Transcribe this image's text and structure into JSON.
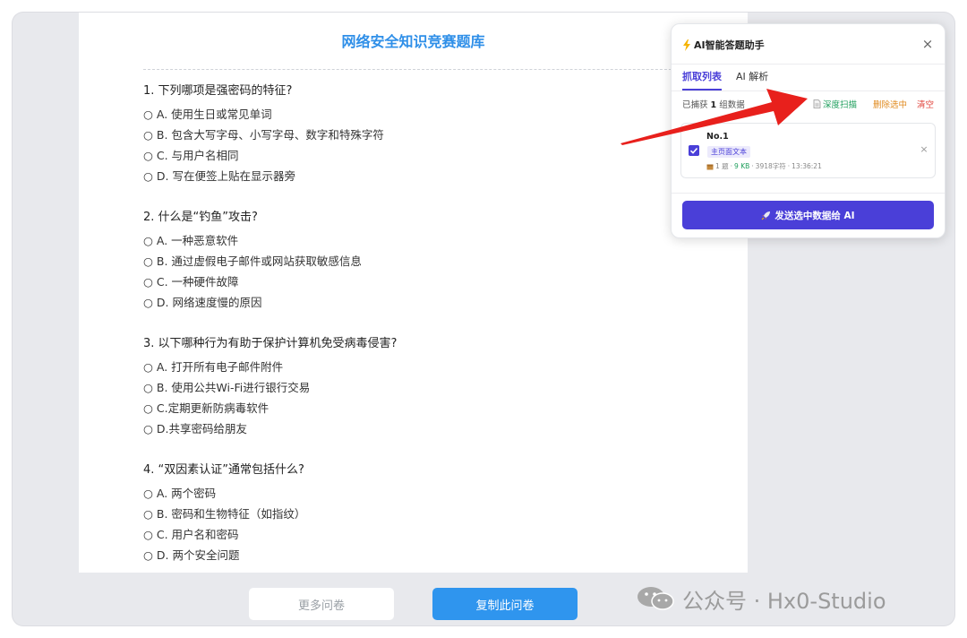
{
  "quiz": {
    "title": "网络安全知识竞赛题库",
    "questions": [
      {
        "text": "1. 下列哪项是强密码的特征?",
        "options": [
          "○ A. 使用生日或常见单词",
          "○ B. 包含大写字母、小写字母、数字和特殊字符",
          "○ C. 与用户名相同",
          "○ D. 写在便签上贴在显示器旁"
        ]
      },
      {
        "text": "2. 什么是“钓鱼”攻击?",
        "options": [
          "○ A. 一种恶意软件",
          "○ B. 通过虚假电子邮件或网站获取敏感信息",
          "○ C. 一种硬件故障",
          "○ D. 网络速度慢的原因"
        ]
      },
      {
        "text": "3. 以下哪种行为有助于保护计算机免受病毒侵害?",
        "options": [
          "○ A. 打开所有电子邮件附件",
          "○ B. 使用公共Wi-Fi进行银行交易",
          "○ C.定期更新防病毒软件",
          "○ D.共享密码给朋友"
        ]
      },
      {
        "text": "4. “双因素认证”通常包括什么?",
        "options": [
          "○ A. 两个密码",
          "○ B. 密码和生物特征（如指纹）",
          "○ C. 用户名和密码",
          "○ D. 两个安全问题"
        ]
      }
    ]
  },
  "buttons": {
    "more": "更多问卷",
    "copy": "复制此问卷"
  },
  "panel": {
    "title": "AI智能答题助手",
    "close": "×",
    "tabs": [
      "抓取列表",
      "AI 解析"
    ],
    "captured_prefix": "已捕获",
    "captured_count": "1",
    "captured_suffix": "组数据",
    "actions": {
      "scan": "深度扫描",
      "delete": "删除选中",
      "clear": "清空"
    },
    "item": {
      "title": "No.1",
      "tag": "主页面文本",
      "count": "1 题",
      "size": "9 KB",
      "chars": "3918字符",
      "time": "13:36:21",
      "remove": "×"
    },
    "send": "发送选中数据给 AI"
  },
  "watermark": {
    "text": "公众号 · Hx0-Studio"
  },
  "colors": {
    "accent": "#4a3fd8",
    "title_blue": "#2f8fe8",
    "copy_button": "#2f95ee",
    "scan_green": "#1e9e5c",
    "delete_orange": "#e08a1e",
    "clear_red": "#e0423a",
    "arrow_red": "#e8201c"
  },
  "icons": {
    "title": "lightning-bolt-icon",
    "scan": "document-icon",
    "meta": "package-icon",
    "send": "rocket-icon",
    "watermark": "wechat-icon"
  }
}
